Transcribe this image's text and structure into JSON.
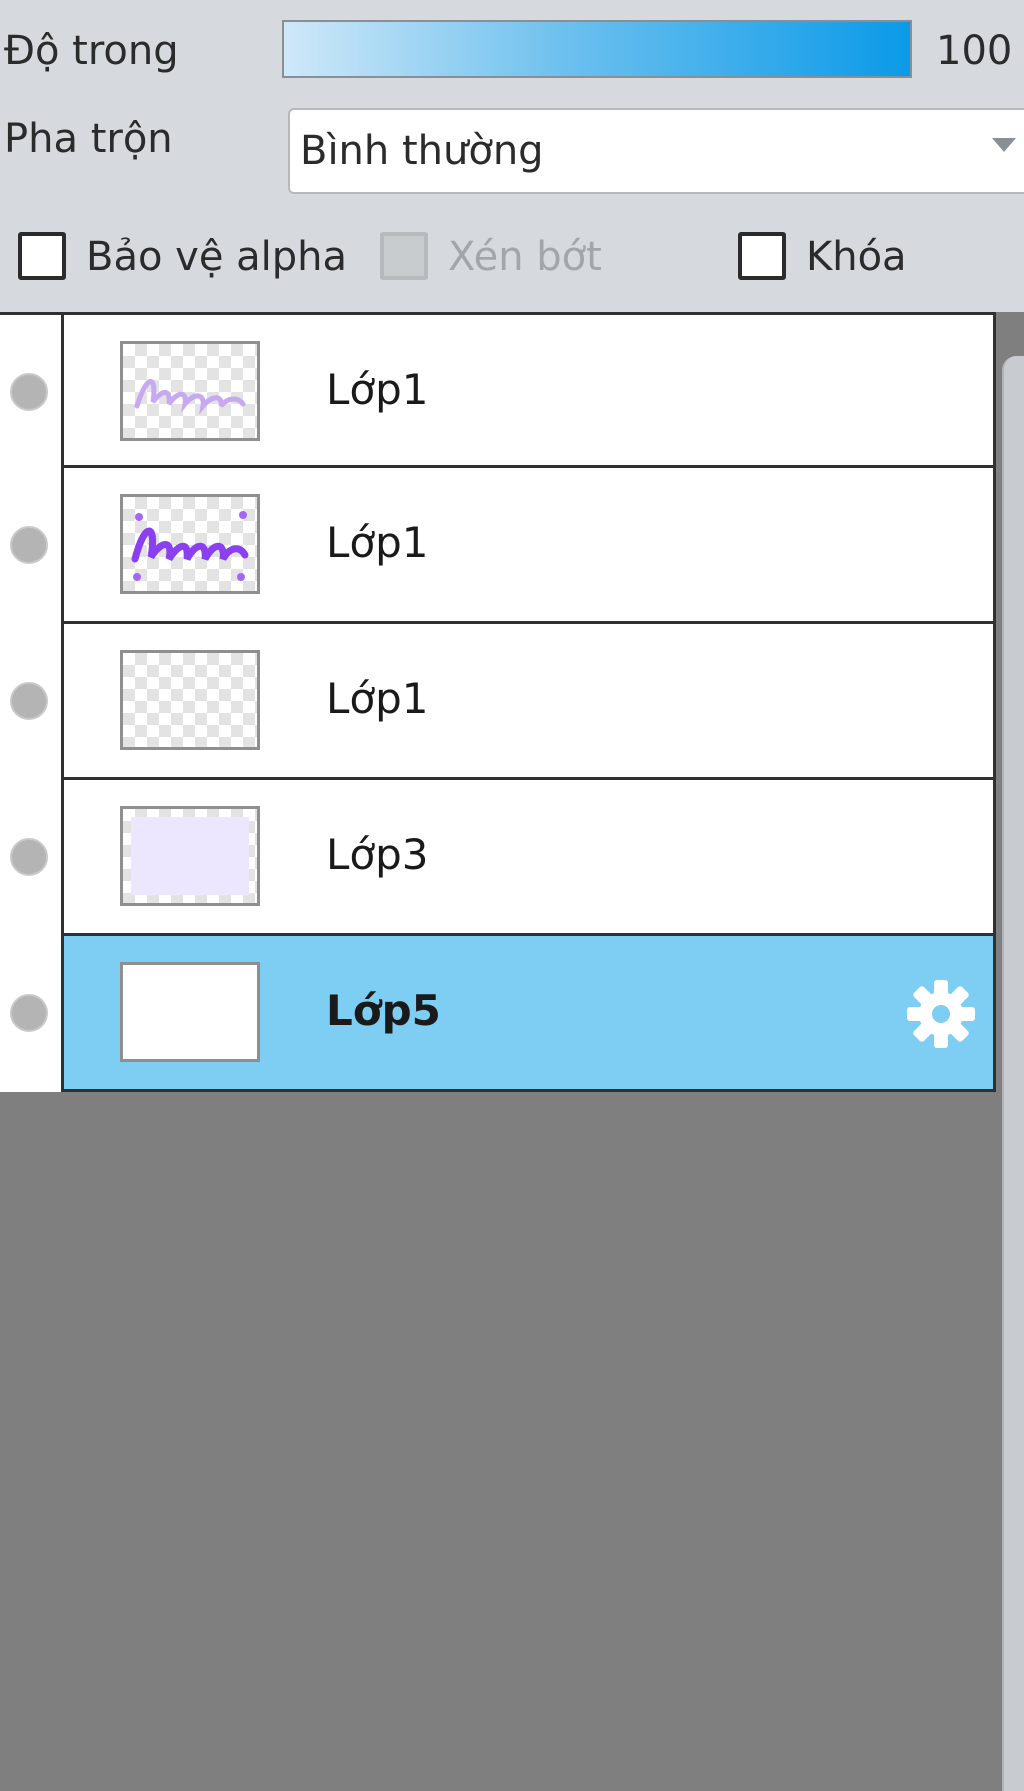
{
  "properties": {
    "opacity_label": "Độ trong",
    "opacity_value_text": "100 %",
    "opacity_fraction": 1.0,
    "blend_label": "Pha trộn",
    "blend_value": "Bình thường",
    "protect_alpha_label": "Bảo vệ alpha",
    "protect_alpha_checked": false,
    "clip_label": "Xén bớt",
    "clip_enabled": false,
    "lock_label": "Khóa",
    "lock_checked": false
  },
  "layers": [
    {
      "name": "Lớp1",
      "thumbnail": "faint-purple-text",
      "selected": false
    },
    {
      "name": "Lớp1",
      "thumbnail": "purple-bun-text",
      "selected": false
    },
    {
      "name": "Lớp1",
      "thumbnail": "transparent",
      "selected": false
    },
    {
      "name": "Lớp3",
      "thumbnail": "lavender-fill",
      "selected": false
    },
    {
      "name": "Lớp5",
      "thumbnail": "white-fill",
      "selected": true
    }
  ],
  "colors": {
    "panel_bg": "#d6dade",
    "selected_row": "#7ecdf3",
    "slider_fill": "#0b9ae8",
    "empty_area": "#7f7f7f"
  },
  "icons": {
    "visibility": "visibility-dot-icon",
    "layer_settings": "gear-icon"
  }
}
